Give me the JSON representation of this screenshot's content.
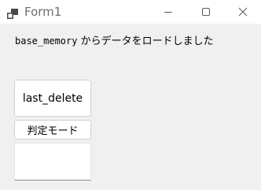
{
  "window": {
    "title": "Form1",
    "icon": "winforms-app-icon",
    "controls": {
      "minimize_icon": "minimize-icon",
      "maximize_icon": "maximize-icon",
      "close_icon": "close-icon"
    }
  },
  "status": {
    "code_text": "base_memory",
    "message": " からデータをロードしました"
  },
  "buttons": {
    "last_delete": "last_delete",
    "judge_mode": "判定モード"
  },
  "textbox": {
    "value": ""
  },
  "colors": {
    "titlebar": "#ffffff",
    "client_area": "#f0f0f0",
    "title_text": "#6e6e6e",
    "button_bg": "#ffffff",
    "button_border": "#d0d0d0"
  }
}
